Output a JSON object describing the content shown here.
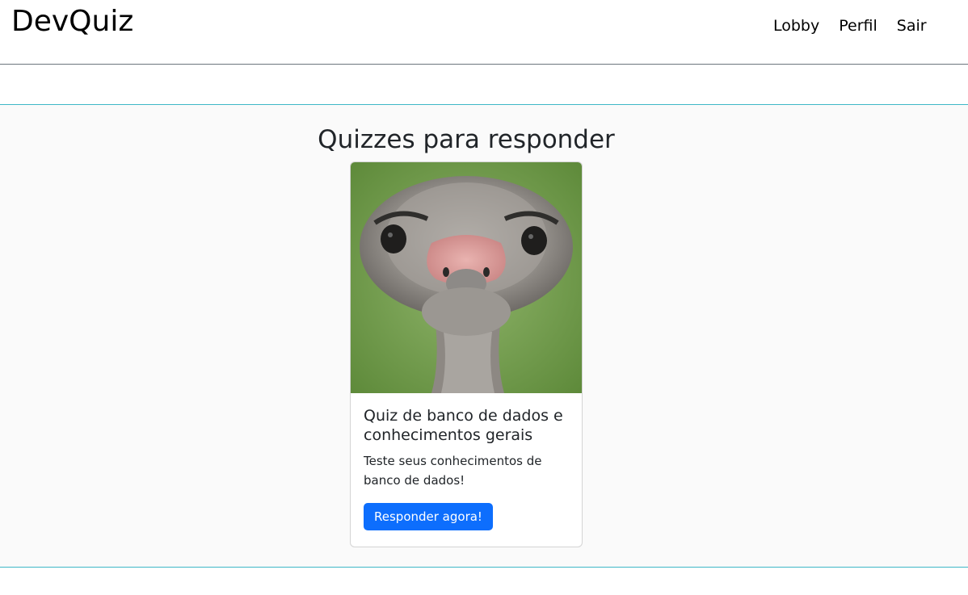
{
  "navbar": {
    "brand": "DevQuiz",
    "links": [
      "Lobby",
      "Perfil",
      "Sair"
    ]
  },
  "main": {
    "title": "Quizzes para responder",
    "quizzes": [
      {
        "image": "ostrich-photo",
        "title": "Quiz de banco de dados e conhecimentos gerais",
        "description": "Teste seus conhecimentos de banco de dados!",
        "button_label": "Responder agora!"
      }
    ]
  },
  "colors": {
    "primary_button": "#0d6efd",
    "section_border": "#3fb8c7"
  }
}
